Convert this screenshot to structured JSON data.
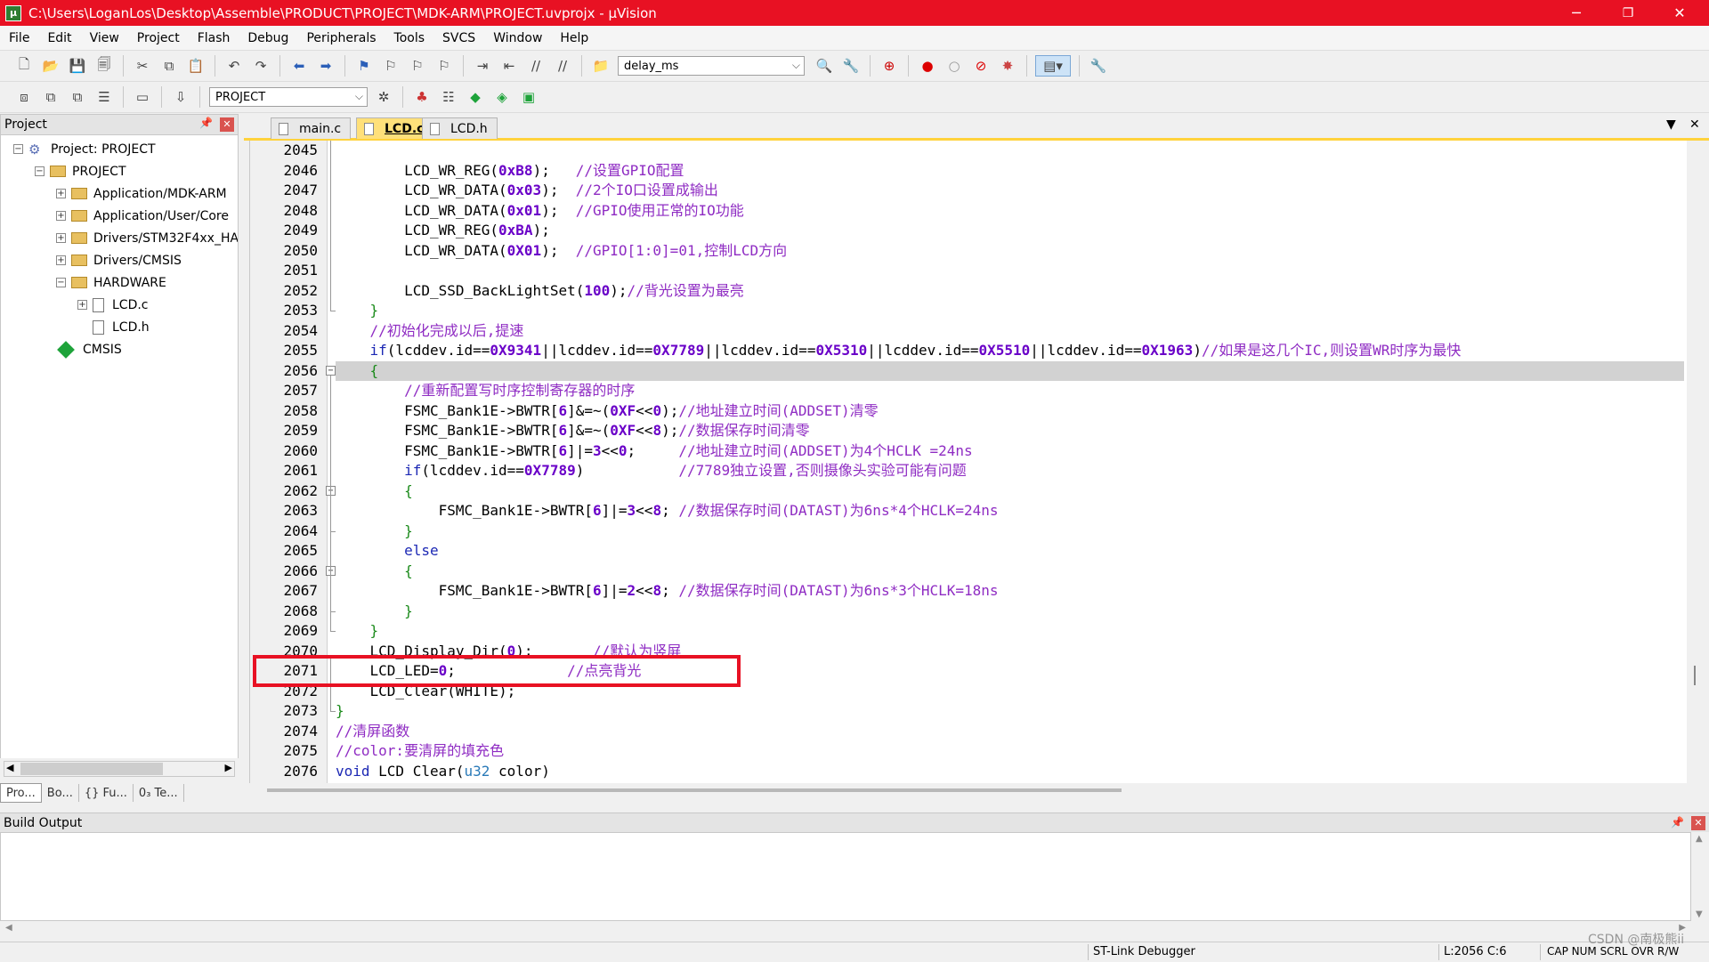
{
  "window": {
    "title": "C:\\Users\\LoganLos\\Desktop\\Assemble\\PRODUCT\\PROJECT\\MDK-ARM\\PROJECT.uvprojx - µVision",
    "minimize": "─",
    "restore": "❐",
    "close": "✕"
  },
  "menu": [
    "File",
    "Edit",
    "View",
    "Project",
    "Flash",
    "Debug",
    "Peripherals",
    "Tools",
    "SVCS",
    "Window",
    "Help"
  ],
  "toolbar": {
    "find_combo": "delay_ms",
    "target_combo": "PROJECT"
  },
  "project_pane": {
    "title": "Project",
    "tree": [
      {
        "label": "Project: PROJECT",
        "level": 0,
        "expander": "−",
        "icon": "project-icon"
      },
      {
        "label": "PROJECT",
        "level": 1,
        "expander": "−",
        "icon": "folder-icon"
      },
      {
        "label": "Application/MDK-ARM",
        "level": 2,
        "expander": "+",
        "icon": "folder-icon"
      },
      {
        "label": "Application/User/Core",
        "level": 2,
        "expander": "+",
        "icon": "folder-icon"
      },
      {
        "label": "Drivers/STM32F4xx_HAL",
        "level": 2,
        "expander": "+",
        "icon": "folder-icon"
      },
      {
        "label": "Drivers/CMSIS",
        "level": 2,
        "expander": "+",
        "icon": "folder-icon"
      },
      {
        "label": "HARDWARE",
        "level": 2,
        "expander": "−",
        "icon": "folder-icon"
      },
      {
        "label": "LCD.c",
        "level": 3,
        "expander": "+",
        "icon": "file-icon"
      },
      {
        "label": "LCD.h",
        "level": 3,
        "expander": "",
        "icon": "file-icon"
      },
      {
        "label": "CMSIS",
        "level": 2,
        "expander": "",
        "icon": "diamond-icon"
      }
    ],
    "bottom_tabs": [
      "Pro...",
      "Bo...",
      "{} Fu...",
      "0₃ Te..."
    ]
  },
  "editor": {
    "tabs": [
      {
        "label": "main.c",
        "active": false
      },
      {
        "label": "LCD.c",
        "active": true
      },
      {
        "label": "LCD.h",
        "active": false
      }
    ],
    "highlight_line": "2056",
    "boxed_line": "2071",
    "lines": [
      {
        "n": "2045",
        "seg": []
      },
      {
        "n": "2046",
        "seg": [
          [
            "f",
            "        LCD_WR_REG("
          ],
          [
            "n",
            "0xB8"
          ],
          [
            "f",
            ");   "
          ],
          [
            "c",
            "//设置GPIO配置"
          ]
        ]
      },
      {
        "n": "2047",
        "seg": [
          [
            "f",
            "        LCD_WR_DATA("
          ],
          [
            "n",
            "0x03"
          ],
          [
            "f",
            ");  "
          ],
          [
            "c",
            "//2个IO口设置成输出"
          ]
        ]
      },
      {
        "n": "2048",
        "seg": [
          [
            "f",
            "        LCD_WR_DATA("
          ],
          [
            "n",
            "0x01"
          ],
          [
            "f",
            ");  "
          ],
          [
            "c",
            "//GPIO使用正常的IO功能"
          ]
        ]
      },
      {
        "n": "2049",
        "seg": [
          [
            "f",
            "        LCD_WR_REG("
          ],
          [
            "n",
            "0xBA"
          ],
          [
            "f",
            ");"
          ]
        ]
      },
      {
        "n": "2050",
        "seg": [
          [
            "f",
            "        LCD_WR_DATA("
          ],
          [
            "n",
            "0X01"
          ],
          [
            "f",
            ");  "
          ],
          [
            "c",
            "//GPIO[1:0]=01,控制LCD方向"
          ]
        ]
      },
      {
        "n": "2051",
        "seg": []
      },
      {
        "n": "2052",
        "seg": [
          [
            "f",
            "        LCD_SSD_BackLightSet("
          ],
          [
            "n",
            "100"
          ],
          [
            "f",
            ");"
          ],
          [
            "c",
            "//背光设置为最亮"
          ]
        ]
      },
      {
        "n": "2053",
        "seg": [
          [
            "b",
            "    }"
          ]
        ]
      },
      {
        "n": "2054",
        "seg": [
          [
            "c",
            "    //初始化完成以后,提速"
          ]
        ]
      },
      {
        "n": "2055",
        "seg": [
          [
            "k",
            "    if"
          ],
          [
            "f",
            "(lcddev.id=="
          ],
          [
            "n",
            "0X9341"
          ],
          [
            "f",
            "||lcddev.id=="
          ],
          [
            "n",
            "0X7789"
          ],
          [
            "f",
            "||lcddev.id=="
          ],
          [
            "n",
            "0X5310"
          ],
          [
            "f",
            "||lcddev.id=="
          ],
          [
            "n",
            "0X5510"
          ],
          [
            "f",
            "||lcddev.id=="
          ],
          [
            "n",
            "0X1963"
          ],
          [
            "f",
            ")"
          ],
          [
            "c",
            "//如果是这几个IC,则设置WR时序为最快"
          ]
        ]
      },
      {
        "n": "2056",
        "seg": [
          [
            "b",
            "    {"
          ]
        ]
      },
      {
        "n": "2057",
        "seg": [
          [
            "c",
            "        //重新配置写时序控制寄存器的时序"
          ]
        ]
      },
      {
        "n": "2058",
        "seg": [
          [
            "f",
            "        FSMC_Bank1E->BWTR["
          ],
          [
            "n",
            "6"
          ],
          [
            "f",
            "]&=~("
          ],
          [
            "n",
            "0XF"
          ],
          [
            "f",
            "<<"
          ],
          [
            "n",
            "0"
          ],
          [
            "f",
            ");"
          ],
          [
            "c",
            "//地址建立时间(ADDSET)清零"
          ]
        ]
      },
      {
        "n": "2059",
        "seg": [
          [
            "f",
            "        FSMC_Bank1E->BWTR["
          ],
          [
            "n",
            "6"
          ],
          [
            "f",
            "]&=~("
          ],
          [
            "n",
            "0XF"
          ],
          [
            "f",
            "<<"
          ],
          [
            "n",
            "8"
          ],
          [
            "f",
            ");"
          ],
          [
            "c",
            "//数据保存时间清零"
          ]
        ]
      },
      {
        "n": "2060",
        "seg": [
          [
            "f",
            "        FSMC_Bank1E->BWTR["
          ],
          [
            "n",
            "6"
          ],
          [
            "f",
            "]|="
          ],
          [
            "n",
            "3"
          ],
          [
            "f",
            "<<"
          ],
          [
            "n",
            "0"
          ],
          [
            "f",
            ";     "
          ],
          [
            "c",
            "//地址建立时间(ADDSET)为4个HCLK =24ns"
          ]
        ]
      },
      {
        "n": "2061",
        "seg": [
          [
            "k",
            "        if"
          ],
          [
            "f",
            "(lcddev.id=="
          ],
          [
            "n",
            "0X7789"
          ],
          [
            "f",
            ")           "
          ],
          [
            "c",
            "//7789独立设置,否则摄像头实验可能有问题"
          ]
        ]
      },
      {
        "n": "2062",
        "seg": [
          [
            "b",
            "        {"
          ]
        ]
      },
      {
        "n": "2063",
        "seg": [
          [
            "f",
            "            FSMC_Bank1E->BWTR["
          ],
          [
            "n",
            "6"
          ],
          [
            "f",
            "]|="
          ],
          [
            "n",
            "3"
          ],
          [
            "f",
            "<<"
          ],
          [
            "n",
            "8"
          ],
          [
            "f",
            "; "
          ],
          [
            "c",
            "//数据保存时间(DATAST)为6ns*4个HCLK=24ns"
          ]
        ]
      },
      {
        "n": "2064",
        "seg": [
          [
            "b",
            "        }"
          ]
        ]
      },
      {
        "n": "2065",
        "seg": [
          [
            "k",
            "        else"
          ]
        ]
      },
      {
        "n": "2066",
        "seg": [
          [
            "b",
            "        {"
          ]
        ]
      },
      {
        "n": "2067",
        "seg": [
          [
            "f",
            "            FSMC_Bank1E->BWTR["
          ],
          [
            "n",
            "6"
          ],
          [
            "f",
            "]|="
          ],
          [
            "n",
            "2"
          ],
          [
            "f",
            "<<"
          ],
          [
            "n",
            "8"
          ],
          [
            "f",
            "; "
          ],
          [
            "c",
            "//数据保存时间(DATAST)为6ns*3个HCLK=18ns"
          ]
        ]
      },
      {
        "n": "2068",
        "seg": [
          [
            "b",
            "        }"
          ]
        ]
      },
      {
        "n": "2069",
        "seg": [
          [
            "b",
            "    }"
          ]
        ]
      },
      {
        "n": "2070",
        "seg": [
          [
            "f",
            "    LCD_Display_Dir("
          ],
          [
            "n",
            "0"
          ],
          [
            "f",
            ");       "
          ],
          [
            "c",
            "//默认为竖屏"
          ]
        ]
      },
      {
        "n": "2071",
        "seg": [
          [
            "f",
            "    LCD_LED="
          ],
          [
            "n",
            "0"
          ],
          [
            "f",
            ";             "
          ],
          [
            "c",
            "//点亮背光"
          ]
        ]
      },
      {
        "n": "2072",
        "seg": [
          [
            "f",
            "    LCD_Clear(WHITE);"
          ]
        ]
      },
      {
        "n": "2073",
        "seg": [
          [
            "b",
            "}"
          ]
        ]
      },
      {
        "n": "2074",
        "seg": [
          [
            "c",
            "//清屏函数"
          ]
        ]
      },
      {
        "n": "2075",
        "seg": [
          [
            "c",
            "//color:要清屏的填充色"
          ]
        ]
      },
      {
        "n": "2076",
        "seg": [
          [
            "k",
            "void"
          ],
          [
            "f",
            " LCD Clear("
          ],
          [
            "t",
            "u32"
          ],
          [
            "f",
            " color)"
          ]
        ]
      }
    ]
  },
  "build_output": {
    "title": "Build Output"
  },
  "statusbar": {
    "debugger": "ST-Link Debugger",
    "position": "L:2056 C:6",
    "flags": "CAP  NUM  SCRL  OVR  R/W",
    "watermark": "CSDN @南极熊ii"
  },
  "colors": {
    "titlebar": "#e81123",
    "active_tab": "#ffe07a",
    "comment": "#8f2cc3",
    "number": "#6a00c8",
    "keyword": "#1c28b4",
    "brace": "#1a8a1a"
  }
}
